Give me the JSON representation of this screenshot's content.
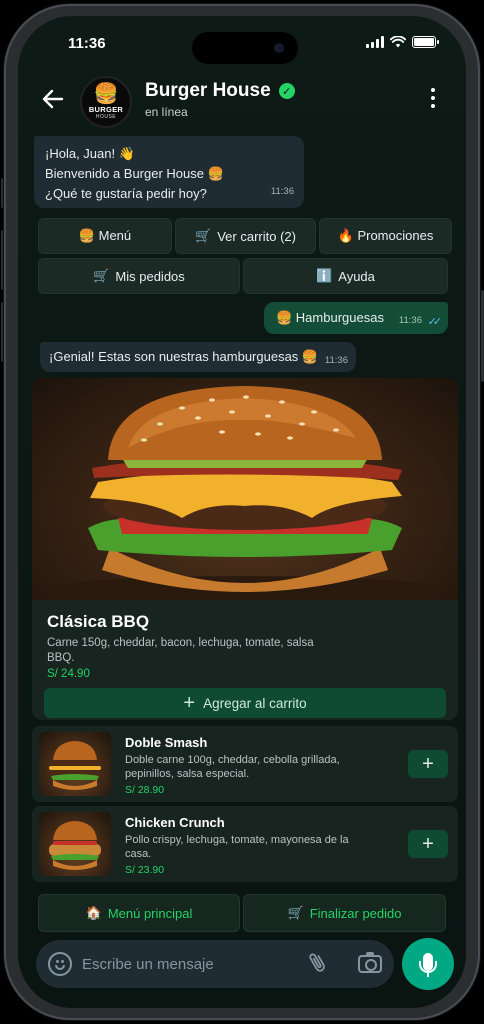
{
  "status_bar": {
    "time": "11:36"
  },
  "header": {
    "name": "Burger House",
    "status": "en línea",
    "avatar_line1": "BURGER",
    "avatar_line2": "HOUSE"
  },
  "messages": {
    "welcome": {
      "line1": "¡Hola, Juan! 👋",
      "line2": "Bienvenido a Burger House 🍔",
      "line3": "¿Qué te gustaría pedir hoy?",
      "time": "11:36"
    },
    "user_reply": {
      "text": "🍔 Hamburguesas",
      "time": "11:36"
    },
    "bot_reply": {
      "text": "¡Genial! Estas son nuestras hamburguesas 🍔",
      "time": "11:36"
    }
  },
  "quick_replies": {
    "menu": "🍔 Menú",
    "cart_icon": "🛒",
    "cart": "Ver carrito (2)",
    "promos": "🔥 Promociones",
    "orders_icon": "🛒",
    "orders": "Mis pedidos",
    "help_icon": "ℹ️",
    "help": "Ayuda"
  },
  "featured": {
    "title": "Clásica BBQ",
    "description": "Carne 150g, cheddar, bacon, lechuga, tomate, salsa BBQ.",
    "price": "S/ 24.90",
    "add_label": "Agregar al carrito"
  },
  "products": [
    {
      "title": "Doble Smash",
      "description": "Doble carne 100g, cheddar, cebolla grillada, pepinillos, salsa especial.",
      "price": "S/ 28.90"
    },
    {
      "title": "Chicken Crunch",
      "description": "Pollo crispy, lechuga, tomate, mayonesa de la casa.",
      "price": "S/ 23.90"
    }
  ],
  "footer_actions": {
    "main_menu_icon": "🏠",
    "main_menu": "Menú principal",
    "checkout_icon": "🛒",
    "checkout": "Finalizar pedido"
  },
  "composer": {
    "placeholder": "Escribe un mensaje"
  },
  "icons": {
    "back": "arrow-left-icon",
    "verified": "verified-check-icon",
    "more": "more-vertical-icon",
    "emoji": "emoji-icon",
    "attach": "paperclip-icon",
    "camera": "camera-icon",
    "mic": "microphone-icon"
  },
  "colors": {
    "accent": "#25d366",
    "mic_button": "#00a884",
    "outgoing_bubble": "#134d37",
    "incoming_bubble": "#1f2c33"
  }
}
